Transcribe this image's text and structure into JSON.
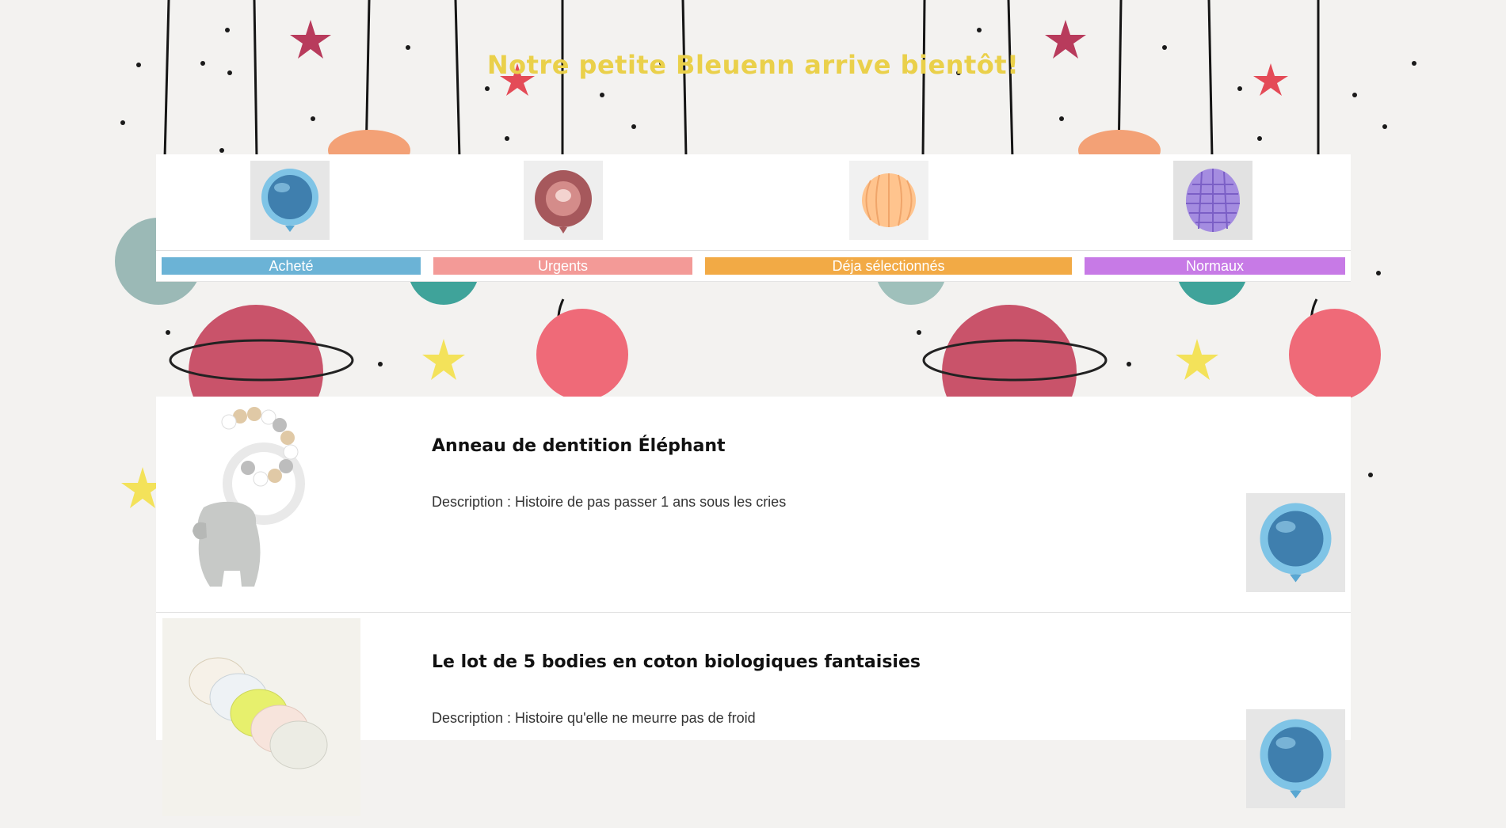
{
  "header": {
    "title": "Notre petite Bleuenn arrive bientôt!"
  },
  "categories": [
    {
      "label": "Acheté",
      "color": "#6bb3d6",
      "icon": "blue-balloon-icon"
    },
    {
      "label": "Urgents",
      "color": "#f39a97",
      "icon": "rose-gold-balloon-icon"
    },
    {
      "label": "Déja sélectionnés",
      "color": "#f2aa45",
      "icon": "peach-honeycomb-icon"
    },
    {
      "label": "Normaux",
      "color": "#c77ae6",
      "icon": "purple-honeycomb-icon"
    }
  ],
  "items": [
    {
      "name": "Anneau de dentition Éléphant",
      "description": "Description : Histoire de pas passer 1 ans sous les cries",
      "status_icon": "blue-balloon-icon"
    },
    {
      "name": "Le lot de 5 bodies en coton biologiques fantaisies",
      "description": "Description : Histoire qu'elle ne meurre pas de froid",
      "status_icon": "blue-balloon-icon"
    }
  ]
}
